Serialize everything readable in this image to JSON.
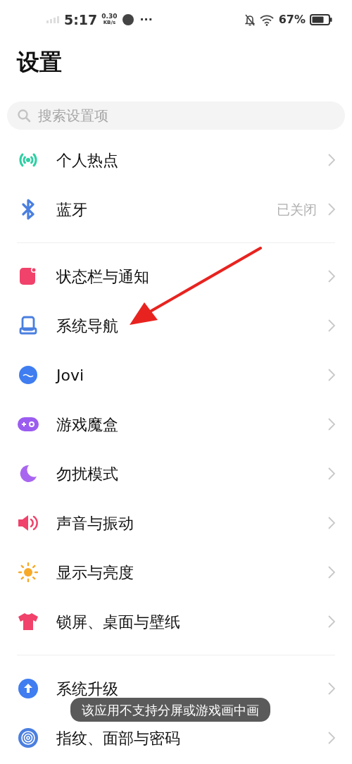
{
  "status_bar": {
    "time": "5:17",
    "speed": "0.30",
    "speed_unit": "KB/s",
    "more": "···",
    "battery": "67%"
  },
  "title": "设置",
  "search": {
    "placeholder": "搜索设置项"
  },
  "groups": [
    {
      "rows": [
        {
          "kind": "hotspot",
          "label": "个人热点"
        },
        {
          "kind": "bluetooth",
          "label": "蓝牙",
          "value": "已关闭"
        }
      ]
    },
    {
      "rows": [
        {
          "kind": "notification",
          "label": "状态栏与通知"
        },
        {
          "kind": "navigation",
          "label": "系统导航"
        },
        {
          "kind": "jovi",
          "label": "Jovi"
        },
        {
          "kind": "game",
          "label": "游戏魔盒"
        },
        {
          "kind": "moon",
          "label": "勿扰模式"
        },
        {
          "kind": "sound",
          "label": "声音与振动"
        },
        {
          "kind": "display",
          "label": "显示与亮度"
        },
        {
          "kind": "wallpaper",
          "label": "锁屏、桌面与壁纸"
        }
      ]
    },
    {
      "rows": [
        {
          "kind": "upgrade",
          "label": "系统升级"
        },
        {
          "kind": "fingerprint",
          "label": "指纹、面部与密码"
        }
      ]
    }
  ],
  "toast": "该应用不支持分屏或游戏画中画"
}
